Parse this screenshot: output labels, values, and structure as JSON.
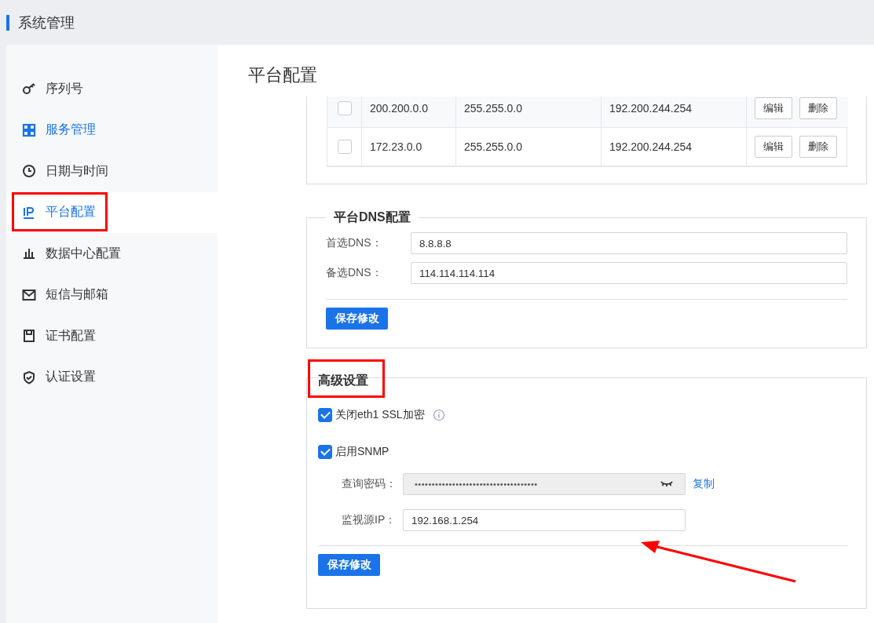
{
  "header": {
    "title": "系统管理"
  },
  "sidebar": {
    "items": [
      {
        "label": "序列号",
        "selected": false,
        "highlighted": false
      },
      {
        "label": "服务管理",
        "selected": false,
        "highlighted": false
      },
      {
        "label": "日期与时间",
        "selected": false,
        "highlighted": false
      },
      {
        "label": "平台配置",
        "selected": true,
        "highlighted": true
      },
      {
        "label": "数据中心配置",
        "selected": false,
        "highlighted": false
      },
      {
        "label": "短信与邮箱",
        "selected": false,
        "highlighted": false
      },
      {
        "label": "证书配置",
        "selected": false,
        "highlighted": false
      },
      {
        "label": "认证设置",
        "selected": false,
        "highlighted": false
      }
    ]
  },
  "page": {
    "title": "平台配置"
  },
  "route_table": {
    "rows": [
      {
        "checked": false,
        "cells": [
          "200.200.0.0",
          "255.255.0.0",
          "192.200.244.254"
        ],
        "actions": [
          "编辑",
          "删除"
        ]
      },
      {
        "checked": false,
        "cells": [
          "172.23.0.0",
          "255.255.0.0",
          "192.200.244.254"
        ],
        "actions": [
          "编辑",
          "删除"
        ]
      }
    ]
  },
  "dns": {
    "legend": "平台DNS配置",
    "fields": [
      {
        "label": "首选DNS：",
        "value": "8.8.8.8"
      },
      {
        "label": "备选DNS：",
        "value": "114.114.114.114"
      }
    ],
    "save": "保存修改"
  },
  "advanced": {
    "legend": "高级设置",
    "highlighted": true,
    "options": [
      {
        "label": "关闭eth1 SSL加密",
        "checked": true,
        "info": true
      },
      {
        "label": "启用SNMP",
        "checked": true,
        "info": false
      }
    ],
    "fields": [
      {
        "kind": "password",
        "label": "查询密码：",
        "value": "••••••••••••••••••••••••••••••••••••",
        "action": "复制"
      },
      {
        "kind": "text",
        "label": "监视源IP：",
        "value": "192.168.1.254"
      }
    ],
    "save": "保存修改"
  }
}
